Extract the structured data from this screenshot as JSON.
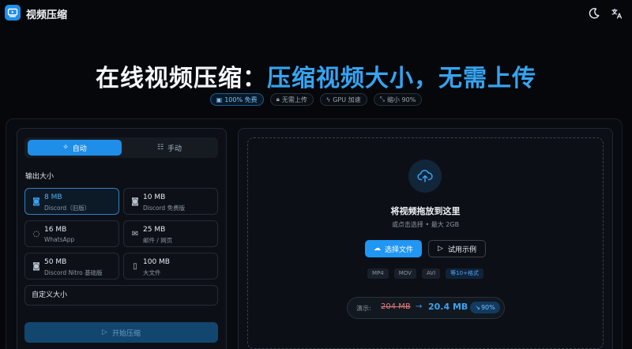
{
  "app": {
    "title": "视频压缩"
  },
  "hero": {
    "title_white": "在线视频压缩：",
    "title_blue": "压缩视频大小，无需上传",
    "chips": [
      {
        "icon": "gift-icon",
        "label": "100% 免费"
      },
      {
        "icon": "lock-icon",
        "label": "无需上传"
      },
      {
        "icon": "bolt-icon",
        "label": "GPU 加速"
      },
      {
        "icon": "shrink-icon",
        "label": "缩小 90%"
      }
    ]
  },
  "mode": {
    "auto": "自动",
    "manual": "手动",
    "selected": "auto"
  },
  "output": {
    "label": "输出大小",
    "options": [
      {
        "size": "8 MB",
        "desc": "Discord（旧版）",
        "icon": "discord-icon",
        "selected": true
      },
      {
        "size": "10 MB",
        "desc": "Discord 免费版",
        "icon": "discord-icon",
        "selected": false
      },
      {
        "size": "16 MB",
        "desc": "WhatsApp",
        "icon": "whatsapp-icon",
        "selected": false
      },
      {
        "size": "25 MB",
        "desc": "邮件 / 网页",
        "icon": "mail-icon",
        "selected": false
      },
      {
        "size": "50 MB",
        "desc": "Discord Nitro 基础版",
        "icon": "discord-icon",
        "selected": false
      },
      {
        "size": "100 MB",
        "desc": "大文件",
        "icon": "file-icon",
        "selected": false
      }
    ],
    "custom": "自定义大小"
  },
  "start_button": "开始压缩",
  "dropzone": {
    "title": "将视频拖放到这里",
    "subtitle": "或点击选择 • 最大 2GB",
    "choose_file": "选择文件",
    "try_sample": "试用示例",
    "formats": [
      "MP4",
      "MOV",
      "AVI"
    ],
    "formats_more": "等10+格式"
  },
  "demo": {
    "label": "演示:",
    "before": "204 MB",
    "after": "20.4 MB",
    "badge": "90%"
  },
  "colors": {
    "accent": "#2196f3",
    "background": "#05070b",
    "highlight": "#36a4f0"
  }
}
